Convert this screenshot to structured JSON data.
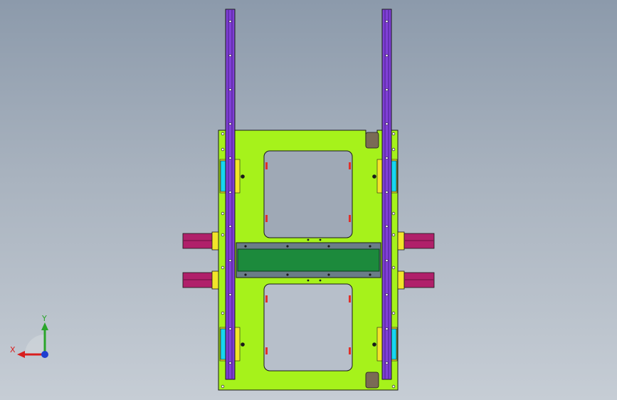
{
  "view": {
    "type": "cad-3d-viewport",
    "background_top": "#8c9aab",
    "background_bottom": "#c6cdd5"
  },
  "colors": {
    "plate": "#a6f21b",
    "rail": "#7f3fd6",
    "rail_dark": "#4b1f8a",
    "slider_block": "#16d7f0",
    "gusset": "#7a6b55",
    "cylinder": "#b0206a",
    "cylinder_collar": "#f2e52a",
    "center_beam": "#1c8a3c",
    "center_beam_frame": "#6a7d88",
    "outline": "#1a1a1a",
    "hole": "#3b3b3b",
    "accent_red": "#e0302a"
  },
  "triad": {
    "x_label": "X",
    "y_label": "Y",
    "x_color": "#d81e1e",
    "y_color": "#2aa52a",
    "z_color": "#1f3fd0"
  }
}
